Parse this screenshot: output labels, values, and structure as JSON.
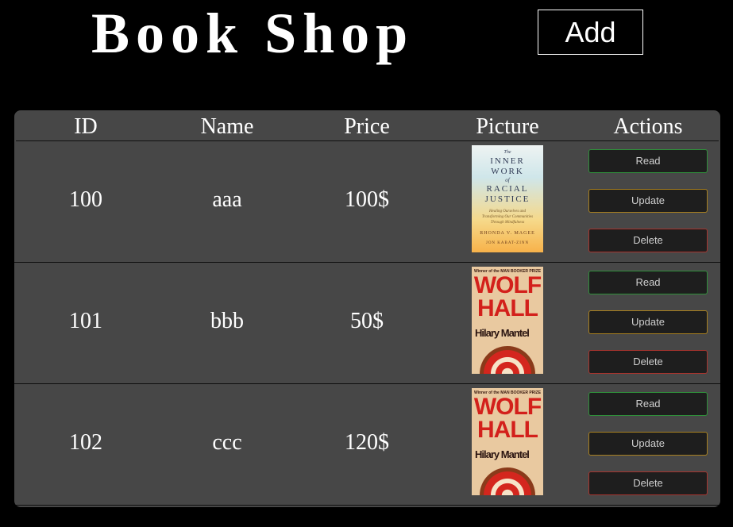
{
  "header": {
    "title": "Book Shop",
    "add_label": "Add"
  },
  "table": {
    "columns": [
      "ID",
      "Name",
      "Price",
      "Picture",
      "Actions"
    ],
    "rows": [
      {
        "id": "100",
        "name": "aaa",
        "price": "100$",
        "cover": {
          "title_lines": [
            "The",
            "INNER",
            "WORK",
            "of",
            "RACIAL",
            "JUSTICE"
          ],
          "subtitle": "Healing Ourselves and Transforming Our Communities Through Mindfulness",
          "author": "RHONDA V. MAGEE",
          "foreword": "JON KABAT-ZINN"
        },
        "actions": {
          "read": "Read",
          "update": "Update",
          "delete": "Delete"
        }
      },
      {
        "id": "101",
        "name": "bbb",
        "price": "50$",
        "cover": {
          "award": "Winner of the MAN BOOKER PRIZE",
          "title_lines": [
            "WOLF",
            "HALL"
          ],
          "author": "Hilary Mantel"
        },
        "actions": {
          "read": "Read",
          "update": "Update",
          "delete": "Delete"
        }
      },
      {
        "id": "102",
        "name": "ccc",
        "price": "120$",
        "cover": {
          "award": "Winner of the MAN BOOKER PRIZE",
          "title_lines": [
            "WOLF",
            "HALL"
          ],
          "author": "Hilary Mantel"
        },
        "actions": {
          "read": "Read",
          "update": "Update",
          "delete": "Delete"
        }
      }
    ]
  },
  "colors": {
    "background": "#000000",
    "table_bg": "#474747",
    "read_border": "#2f8f3a",
    "update_border": "#a8801f",
    "delete_border": "#a8342e"
  }
}
